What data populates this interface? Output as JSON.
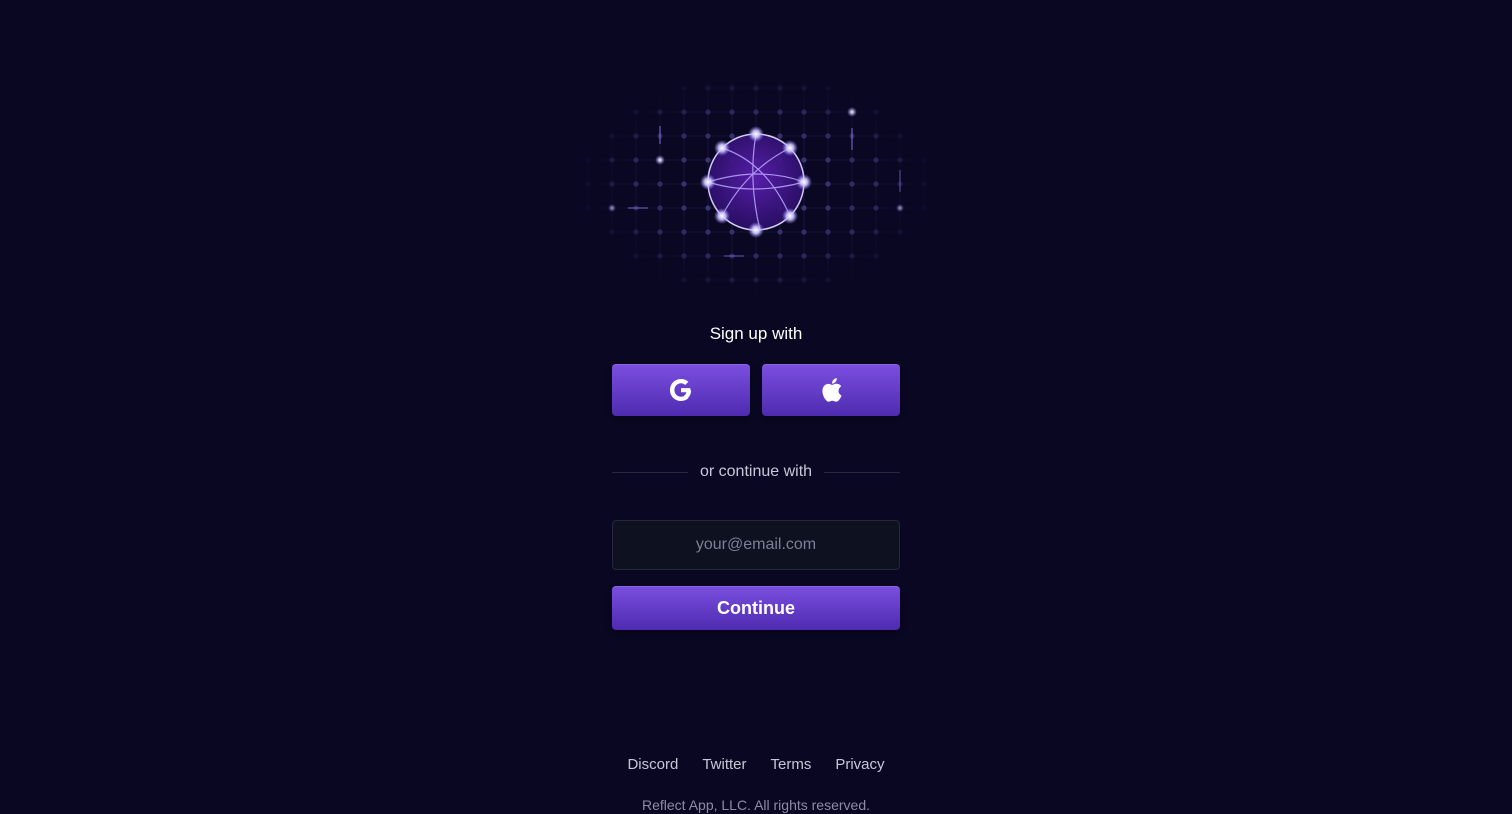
{
  "signup": {
    "title": "Sign up with",
    "google_icon": "google-icon",
    "apple_icon": "apple-icon"
  },
  "divider": {
    "text": "or continue with"
  },
  "email": {
    "placeholder": "your@email.com",
    "value": ""
  },
  "continue_button": {
    "label": "Continue"
  },
  "footer": {
    "links": [
      "Discord",
      "Twitter",
      "Terms",
      "Privacy"
    ],
    "copyright": "Reflect App, LLC. All rights reserved."
  },
  "colors": {
    "background": "#0a0722",
    "button_top": "#7b4fe0",
    "button_bottom": "#4e2bb0",
    "accent_glow": "#e6e2ff"
  }
}
